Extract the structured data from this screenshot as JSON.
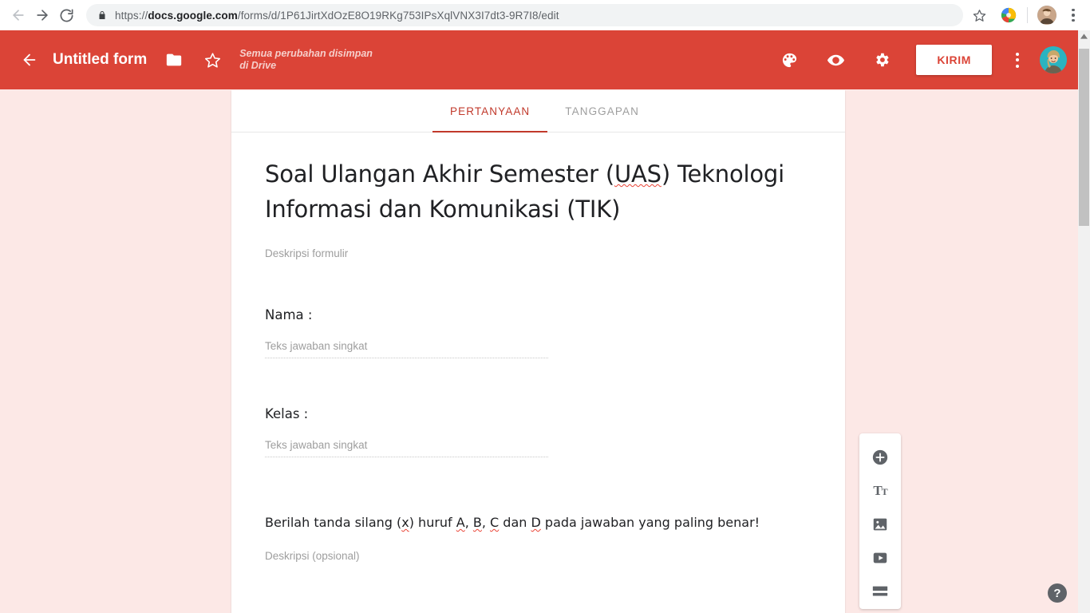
{
  "browser": {
    "back_icon": "back-arrow-icon",
    "forward_icon": "forward-arrow-icon",
    "reload_icon": "reload-icon",
    "lock_icon": "lock-icon",
    "url_scheme": "https://",
    "url_host": "docs.google.com",
    "url_path": "/forms/d/1P61JirtXdOzE8O19RKg753IPsXqlVNX3I7dt3-9R7I8/edit",
    "url_full": "https://docs.google.com/forms/d/1P61JirtXdOzE8O19RKg753IPsXqlVNX3I7dt3-9R7I8/edit",
    "bookmark_icon": "star-icon",
    "extension_icon": "extension-icon",
    "profile_icon": "profile-avatar",
    "menu_icon": "three-dot-menu-icon"
  },
  "header": {
    "back_icon": "back-arrow-icon",
    "title": "Untitled form",
    "folder_icon": "folder-icon",
    "star_icon": "star-outline-icon",
    "save_status": "Semua perubahan disimpan di Drive",
    "theme_icon": "palette-icon",
    "preview_icon": "eye-icon",
    "settings_icon": "gear-icon",
    "send_label": "KIRIM",
    "more_icon": "three-dot-menu-icon",
    "avatar_icon": "user-avatar",
    "bg_color": "#db4437",
    "accent_color": "#c1392b"
  },
  "tabs": [
    {
      "label": "PERTANYAAN",
      "active": true
    },
    {
      "label": "TANGGAPAN",
      "active": false
    }
  ],
  "form": {
    "title_line1": "Soal Ulangan Akhir Semester (",
    "title_misspelled": "UAS",
    "title_line2": ") Teknologi Informasi dan Komunikasi (TIK)",
    "title_full": "Soal Ulangan Akhir Semester (UAS) Teknologi Informasi dan Komunikasi (TIK)",
    "description_placeholder": "Deskripsi formulir",
    "questions": [
      {
        "label": "Nama :",
        "answer_placeholder": "Teks jawaban singkat"
      },
      {
        "label": "Kelas :",
        "answer_placeholder": "Teks jawaban singkat"
      }
    ],
    "section": {
      "title_a": "Berilah tanda silang (",
      "title_x": "x",
      "title_b": ") huruf ",
      "title_A": "A",
      "title_c": ", ",
      "title_B": "B",
      "title_d": ", ",
      "title_C": "C",
      "title_e": " dan ",
      "title_D": "D",
      "title_f": " pada jawaban yang paling benar!",
      "title_full": "Berilah tanda silang (x) huruf A, B, C dan D pada jawaban yang paling benar!",
      "description_placeholder": "Deskripsi (opsional)"
    }
  },
  "toolbar": {
    "items": [
      {
        "icon": "add-question-icon",
        "name": "add-question"
      },
      {
        "icon": "add-title-icon",
        "name": "add-title-description",
        "glyph": "T"
      },
      {
        "icon": "add-image-icon",
        "name": "add-image"
      },
      {
        "icon": "add-video-icon",
        "name": "add-video"
      },
      {
        "icon": "add-section-icon",
        "name": "add-section"
      }
    ]
  },
  "help": {
    "label": "?",
    "icon": "help-icon"
  },
  "scrollbar": {
    "up_arrow_icon": "scroll-up-arrow-icon"
  },
  "colors": {
    "header_red": "#db4437",
    "page_background": "#fce8e6",
    "card_white": "#ffffff",
    "active_tab": "#c1392b",
    "muted_text": "#9e9e9e"
  }
}
